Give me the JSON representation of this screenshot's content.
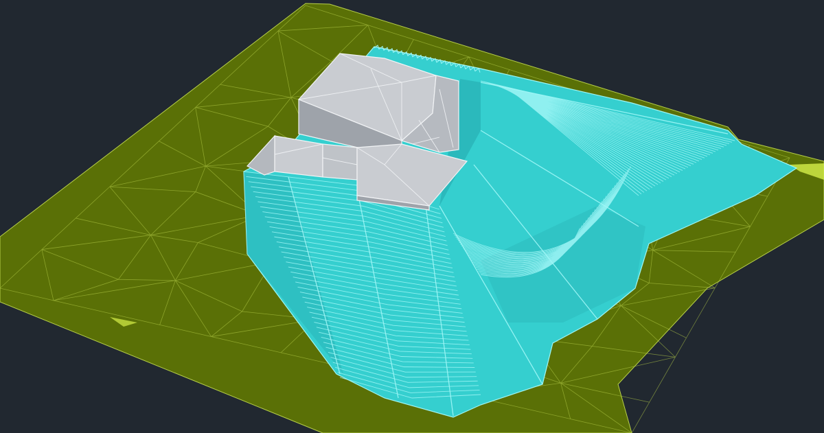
{
  "viewport": {
    "background_color": "#212830"
  },
  "scene": {
    "terrain_surface": {
      "fill_color": "#5a7006",
      "edge_color": "#b8d04a",
      "highlight_color": "#d6f04a"
    },
    "excavation_surface": {
      "fill_color": "#35cfcf",
      "edge_color": "#9ff6f6",
      "shadow_color": "#1f9ea5"
    },
    "building_mass": {
      "fill_color": "#c9ccd1",
      "edge_color": "#f2f4f6",
      "shadow_color": "#9ea3aa"
    }
  }
}
